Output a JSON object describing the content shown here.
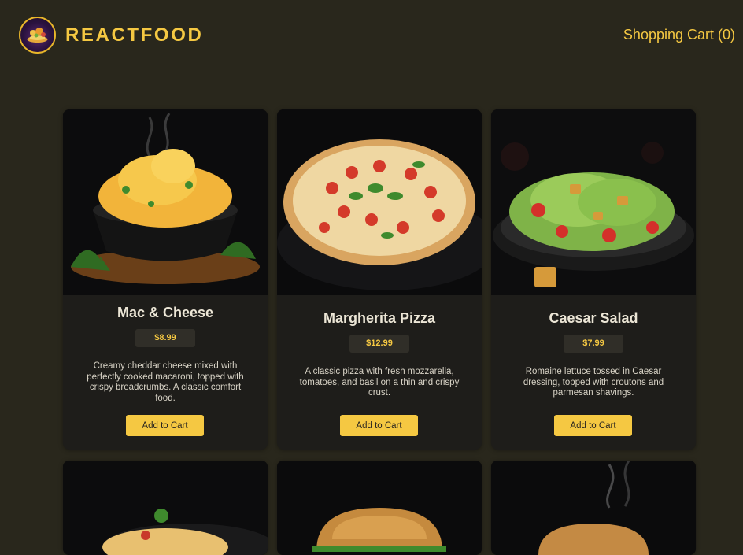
{
  "header": {
    "brand": "REACTFOOD",
    "cart_label": "Shopping Cart (0)"
  },
  "meals": [
    {
      "name": "Mac & Cheese",
      "price": "$8.99",
      "description": "Creamy cheddar cheese mixed with perfectly cooked macaroni, topped with crispy breadcrumbs. A classic comfort food.",
      "button": "Add to Cart",
      "icon": "mac-and-cheese-image"
    },
    {
      "name": "Margherita Pizza",
      "price": "$12.99",
      "description": "A classic pizza with fresh mozzarella, tomatoes, and basil on a thin and crispy crust.",
      "button": "Add to Cart",
      "icon": "pizza-image"
    },
    {
      "name": "Caesar Salad",
      "price": "$7.99",
      "description": "Romaine lettuce tossed in Caesar dressing, topped with croutons and parmesan shavings.",
      "button": "Add to Cart",
      "icon": "salad-image"
    }
  ],
  "colors": {
    "background": "#29271c",
    "accent": "#f5c842",
    "card": "#1e1d1a"
  }
}
